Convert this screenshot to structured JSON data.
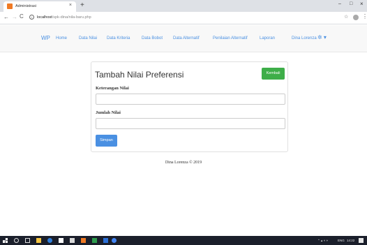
{
  "browser": {
    "tab_title": "Administrasi",
    "tab_close": "×",
    "new_tab": "+",
    "url_host": "localhost",
    "url_path": "/spk-dina/nila-baru.php",
    "window_min": "–",
    "window_max": "□",
    "window_close": "×"
  },
  "navbar": {
    "brand": "WP",
    "links": [
      "Home",
      "Data Nilai",
      "Data Kriteria",
      "Data Bobot",
      "Data Alternatif",
      "Penilaian Alternatif",
      "Laporan",
      "Dina Lorenza"
    ],
    "settings_icon": "gear-icon"
  },
  "form": {
    "title": "Tambah Nilai Preferensi",
    "back_button": "Kembali",
    "field1_label": "Keterangan Nilai",
    "field1_value": "",
    "field2_label": "Jumlah Nilai",
    "field2_value": "",
    "save_button": "Simpan"
  },
  "footer": {
    "text": "Dina Lorenza © 2019"
  },
  "taskbar": {
    "lang": "ENG",
    "time": "14:22"
  },
  "colors": {
    "link": "#4a90e2",
    "success": "#3eae49",
    "primary": "#4a90e2",
    "taskbar": "#1b1f2b"
  }
}
